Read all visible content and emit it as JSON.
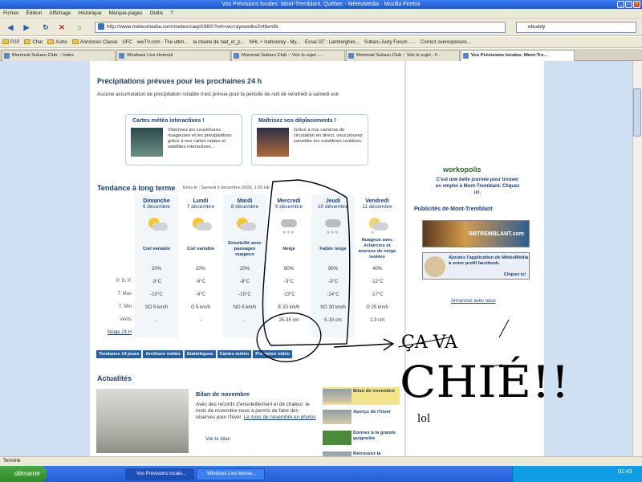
{
  "window": {
    "title": "Vos Prévisions locales: Mont-Tremblant, Québec - MétéoMédia - Mozilla Firefox"
  },
  "menu": [
    "Fichier",
    "Édition",
    "Affichage",
    "Historique",
    "Marque-pages",
    "Outils",
    "?"
  ],
  "address": {
    "url": "http://www.meteomedia.com/meteo/caqc0360/?ref=wcrrayewotkv2#tfemifx",
    "search": "ebuddy"
  },
  "bookmarks": [
    "P2P",
    "Char",
    "Autre",
    "Annonces Classé",
    "UFC",
    "wwTV.com - The ultim...",
    "la chaine de nad_et_p...",
    "NHL + Icehockey - My...",
    "Essai GT : Lamborghini...",
    "Subaru Justy Forum - ...",
    "Correct overexposure..."
  ],
  "tabs": [
    "Montreal Subaru Club :: Index",
    "Windows Live Hotmail",
    "Montreal Subaru Club :: Voir le sujet -...",
    "Montreal Subaru Club :: Voir le sujet - F...",
    "Vos Prévisions locales: Mont-Tre..."
  ],
  "precip": {
    "heading": "Précipitations prévues pour les prochaines 24 h",
    "text": "Aucune accumulation de précipitation notable n'est prévue pour la période de nuit de vendredi à samedi soir."
  },
  "promos": [
    {
      "title": "Cartes météo interactives !",
      "text": "Visionnez les couvertures nuageuses et les précipitations grâce à nos cartes radars et satellites interactives..."
    },
    {
      "title": "Maîtrisez vos déplacements !",
      "text": "Grâce à nos caméras de circulation en direct, vous pouvez surveiller les conditions routières."
    }
  ],
  "trend": {
    "heading": "Tendance à long terme",
    "issued": "Émis le : Samedi 5 décembre 2009, 1:00 HE",
    "row_labels": [
      "P. D. P.",
      "T. Max",
      "T. Min",
      "Vents",
      "Neige 24 H"
    ],
    "days": [
      {
        "name": "Dimanche",
        "date": "6 décembre",
        "desc": "Ciel variable",
        "pdp": "20%",
        "tmax": "-3°C",
        "tmin": "-10°C",
        "wind": "SO 5 km/h",
        "snow": "-",
        "icon": "sun-cloud"
      },
      {
        "name": "Lundi",
        "date": "7 décembre",
        "desc": "Ciel variable",
        "pdp": "20%",
        "tmax": "-6°C",
        "tmin": "-9°C",
        "wind": "O 5 km/h",
        "snow": "-",
        "icon": "sun-cloud"
      },
      {
        "name": "Mardi",
        "date": "8 décembre",
        "desc": "Ensoleillé avec passages nuageux",
        "pdp": "20%",
        "tmax": "-8°C",
        "tmin": "-15°C",
        "wind": "NO 5 km/h",
        "snow": "-",
        "icon": "sun-cloud"
      },
      {
        "name": "Mercredi",
        "date": "9 décembre",
        "desc": "Neige",
        "pdp": "80%",
        "tmax": "-3°C",
        "tmin": "-13°C",
        "wind": "E 20 km/h",
        "snow": "25-35 cm",
        "icon": "snow"
      },
      {
        "name": "Jeudi",
        "date": "10 décembre",
        "desc": "Faible neige",
        "pdp": "90%",
        "tmax": "-3°C",
        "tmin": "-14°C",
        "wind": "SO 30 km/h",
        "snow": "5-10 cm",
        "icon": "snow"
      },
      {
        "name": "Vendredi",
        "date": "11 décembre",
        "desc": "Nuageux avec éclaircies et averses de neige isolées",
        "pdp": "40%",
        "tmax": "-12°C",
        "tmin": "-17°C",
        "wind": "O 25 km/h",
        "snow": "1-3 cm",
        "icon": "cloud-snow"
      }
    ]
  },
  "nav_buttons": [
    "Tendance 14 jours",
    "Archives météo",
    "Statistiques",
    "Cartes météo",
    "Prévision vidéo"
  ],
  "news": {
    "heading": "Actualités",
    "title": "Bilan de novembre",
    "body": "Avec des records d'ensoleillement et de chaleur, le mois de novembre nous a permis de faire des réserves pour l'hiver.",
    "link": "Le mois de novembre en photos",
    "more": "Voir le bilan",
    "side": [
      "Bilan de novembre",
      "Aperçu de l'hiver",
      "Donnez à la grande guignolée",
      "Retrouvez la"
    ]
  },
  "sidebar": {
    "workopolis_text": "C'est une belle journée pour trouver un emploi à Mont-Tremblant. Cliquez ici.",
    "workopolis_brand": "workopolis",
    "ads_heading": "Publicités de Mont-Tremblant",
    "ad1": "BBTREMBLANT.com",
    "ad2_text": "Ajoutez l'application de MétéoMédia à votre profil facebook.",
    "ad2_cta": "Cliquez ici",
    "advertise": "Annoncez avec nous"
  },
  "status": "Terminé",
  "taskbar": {
    "start": "démarrer",
    "tasks": [
      "Vos Prévisions locale...",
      "Windows Live Messe..."
    ],
    "clock": "01:43"
  },
  "annotation": {
    "line1": "ÇA VA",
    "line2": "CHIÉ!!",
    "line3": "lol"
  },
  "colors": {
    "accent": "#1c3f73",
    "page_bg": "#cfe0f2",
    "button": "#2a5f99"
  }
}
